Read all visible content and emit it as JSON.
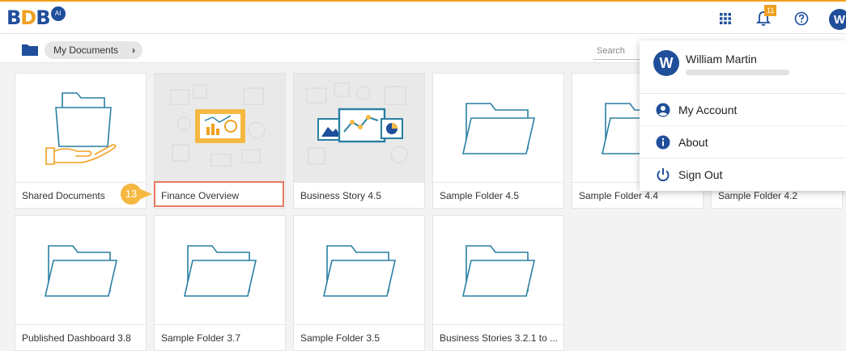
{
  "app": {
    "logo_text": "BDB",
    "logo_badge": "AI"
  },
  "topbar": {
    "notification_count": "11",
    "avatar_initial": "W"
  },
  "breadcrumb": {
    "label": "My Documents",
    "chevron": "›"
  },
  "search": {
    "placeholder": "Search"
  },
  "tiles_row1": [
    {
      "label": "Shared Documents"
    },
    {
      "label": "Finance Overview"
    },
    {
      "label": "Business Story 4.5"
    },
    {
      "label": "Sample Folder 4.5"
    },
    {
      "label": "Sample Folder 4.4"
    },
    {
      "label": "Sample Folder 4.2"
    }
  ],
  "tiles_row2": [
    {
      "label": "Published Dashboard 3.8"
    },
    {
      "label": "Sample Folder 3.7"
    },
    {
      "label": "Sample Folder 3.5"
    },
    {
      "label": "Business Stories 3.2.1 to ..."
    }
  ],
  "step_marker": "13",
  "user_menu": {
    "initial": "W",
    "name": "William Martin",
    "items": [
      {
        "label": "My Account",
        "icon": "user-icon"
      },
      {
        "label": "About",
        "icon": "info-icon"
      },
      {
        "label": "Sign Out",
        "icon": "power-icon"
      }
    ]
  },
  "colors": {
    "brand": "#1f4e9a",
    "accent": "#f0a020",
    "highlight": "#e57a5f",
    "folder_outline": "#2a7fa3"
  }
}
